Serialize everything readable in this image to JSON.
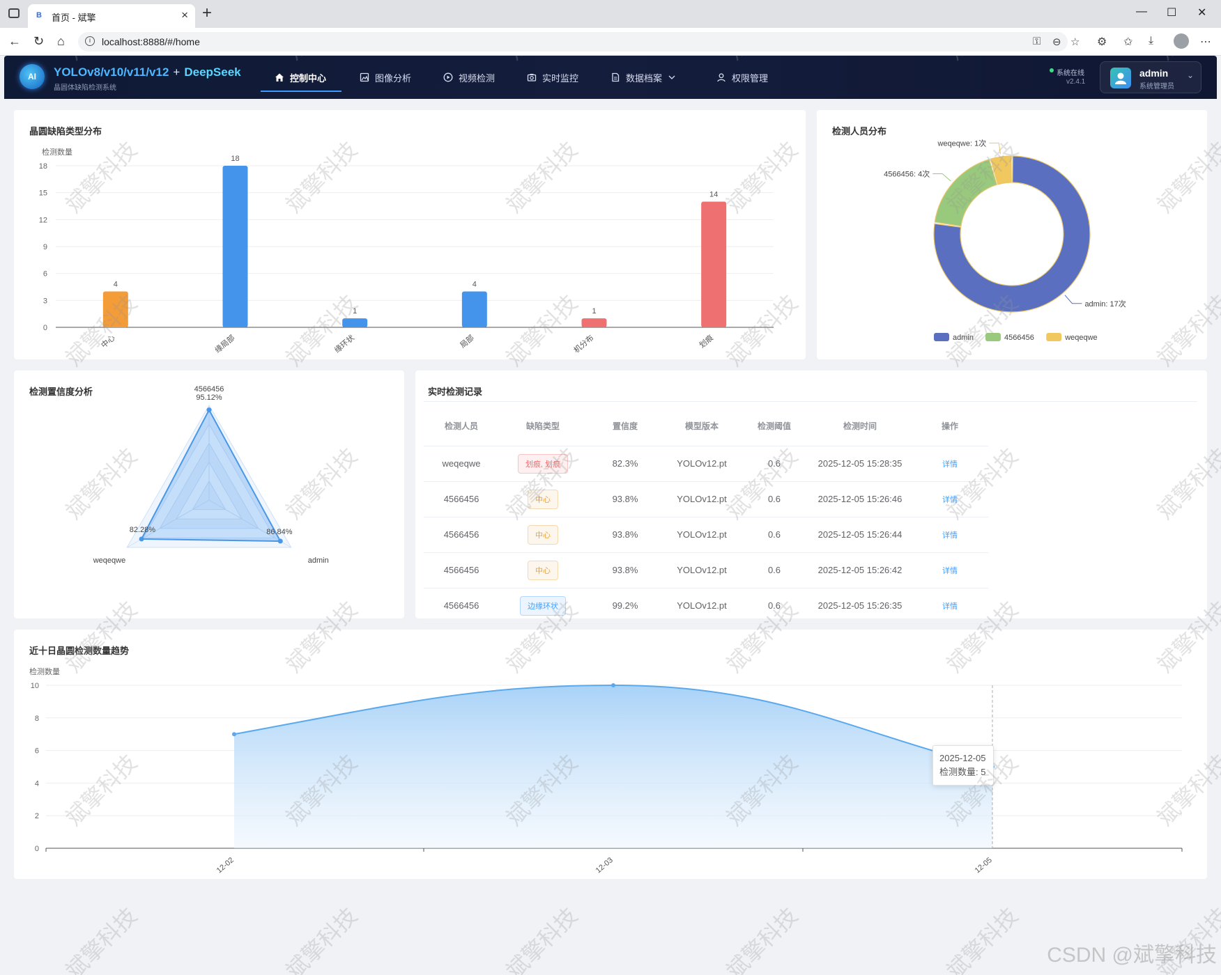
{
  "browser": {
    "tab_favicon": "B",
    "tab_title": "首页 - 斌擎",
    "url": "localhost:8888/#/home"
  },
  "app": {
    "logo_text": "AI",
    "brand_main": "YOLOv8/v10/v11/v12",
    "brand_plus": "+",
    "brand_ds": "DeepSeek",
    "brand_sub": "晶圆体缺陷检测系统",
    "nav": [
      {
        "label": "控制中心",
        "icon": "home-icon"
      },
      {
        "label": "图像分析",
        "icon": "image-icon"
      },
      {
        "label": "视频检测",
        "icon": "play-circle-icon"
      },
      {
        "label": "实时监控",
        "icon": "camera-icon"
      },
      {
        "label": "数据档案",
        "icon": "document-icon"
      },
      {
        "label": "权限管理",
        "icon": "user-icon"
      }
    ],
    "status_text": "系统在线",
    "version": "v2.4.1",
    "user_name": "admin",
    "user_role": "系统管理员"
  },
  "defect_chart": {
    "title": "晶圆缺陷类型分布",
    "chart_data": {
      "type": "bar",
      "ylabel": "检测数量",
      "ylim": [
        0,
        18
      ],
      "yticks": [
        0,
        3,
        6,
        9,
        12,
        15,
        18
      ],
      "categories": [
        "中心",
        "边缘局部",
        "边缘环状",
        "局部",
        "随机分布",
        "划痕"
      ],
      "tick_labels_visible": [
        "中心",
        "缘局部",
        "缘环状",
        "局部",
        "机分布",
        "划痕"
      ],
      "values": [
        4,
        18,
        1,
        4,
        1,
        14
      ],
      "colors": [
        "#f39c38",
        "#4594ec",
        "#4594ec",
        "#4594ec",
        "#ef7070",
        "#ef7070"
      ]
    }
  },
  "staff_chart": {
    "title": "检测人员分布",
    "chart_data": {
      "type": "pie",
      "labels": [
        "admin",
        "4566456",
        "weqeqwe"
      ],
      "values": [
        17,
        4,
        1
      ],
      "slice_labels": [
        "admin: 17次",
        "4566456: 4次",
        "weqeqwe: 1次"
      ],
      "colors": [
        "#5a6fc0",
        "#99c97c",
        "#f1c85f"
      ],
      "legend": "bottom"
    }
  },
  "radar_chart": {
    "title": "检测置信度分析",
    "chart_data": {
      "type": "radar",
      "axes": [
        "4566456",
        "admin",
        "weqeqwe"
      ],
      "values": [
        95.12,
        86.84,
        82.28
      ],
      "value_labels": [
        "95.12%",
        "86.84%",
        "82.28%"
      ],
      "max": 100
    }
  },
  "records": {
    "title": "实时检测记录",
    "headers": [
      "检测人员",
      "缺陷类型",
      "置信度",
      "模型版本",
      "检测阈值",
      "检测时间",
      "操作"
    ],
    "rows": [
      {
        "user": "weqeqwe",
        "defect": "划痕, 划痕",
        "tag": "danger",
        "conf": "82.3%",
        "model": "YOLOv12.pt",
        "thr": "0.6",
        "time": "2025-12-05 15:28:35",
        "action": "详情"
      },
      {
        "user": "4566456",
        "defect": "中心",
        "tag": "warning",
        "conf": "93.8%",
        "model": "YOLOv12.pt",
        "thr": "0.6",
        "time": "2025-12-05 15:26:46",
        "action": "详情"
      },
      {
        "user": "4566456",
        "defect": "中心",
        "tag": "warning",
        "conf": "93.8%",
        "model": "YOLOv12.pt",
        "thr": "0.6",
        "time": "2025-12-05 15:26:44",
        "action": "详情"
      },
      {
        "user": "4566456",
        "defect": "中心",
        "tag": "warning",
        "conf": "93.8%",
        "model": "YOLOv12.pt",
        "thr": "0.6",
        "time": "2025-12-05 15:26:42",
        "action": "详情"
      },
      {
        "user": "4566456",
        "defect": "边缘环状",
        "tag": "primary",
        "conf": "99.2%",
        "model": "YOLOv12.pt",
        "thr": "0.6",
        "time": "2025-12-05 15:26:35",
        "action": "详情"
      }
    ]
  },
  "trend_chart": {
    "title": "近十日晶圆检测数量趋势",
    "tooltip_date": "2025-12-05",
    "tooltip_value": "检测数量: 5",
    "chart_data": {
      "type": "area",
      "ylabel": "检测数量",
      "ylim": [
        0,
        10
      ],
      "yticks": [
        0,
        2,
        4,
        6,
        8,
        10
      ],
      "x": [
        "12-02",
        "12-03",
        "12-05"
      ],
      "values": [
        7,
        10,
        5
      ],
      "color": "#5aa9ee"
    }
  },
  "watermark": "斌擎科技",
  "footer_watermark": "CSDN @斌擎科技"
}
